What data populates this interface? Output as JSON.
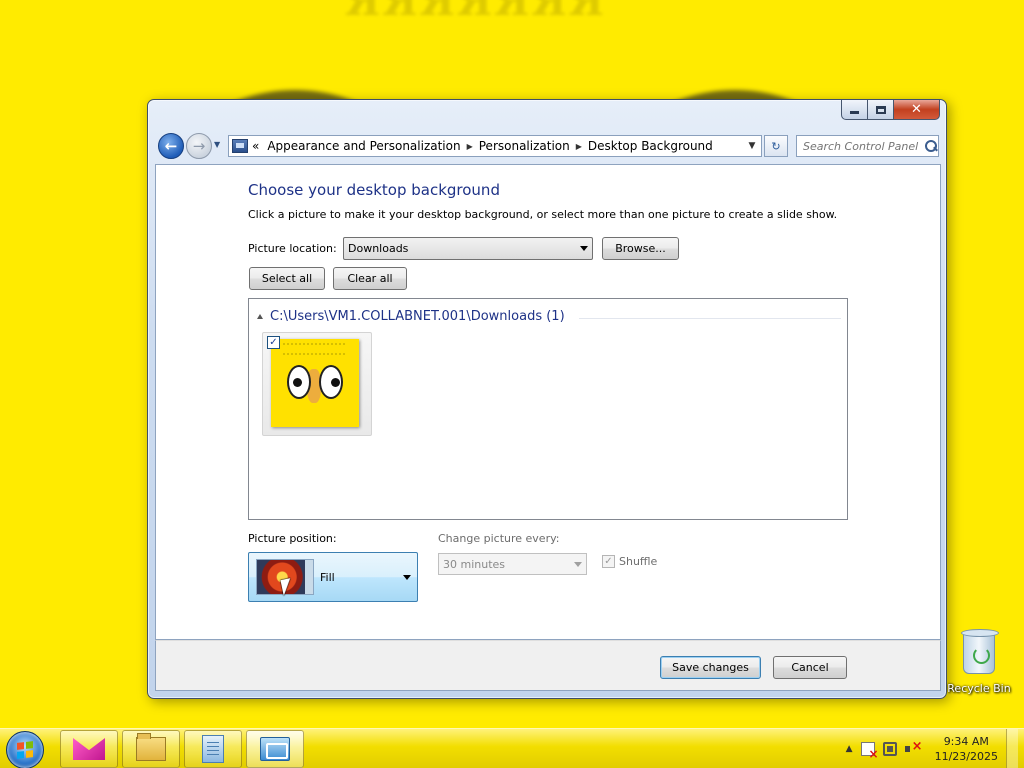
{
  "window": {
    "caption_buttons": {
      "minimize_icon": "minimize-icon",
      "maximize_icon": "maximize-icon",
      "close_icon": "close-icon",
      "close_glyph": "✕"
    }
  },
  "nav": {
    "back_glyph": "←",
    "forward_glyph": "→",
    "recent_glyph": "▼",
    "address_prefix": "«",
    "breadcrumb": [
      "Appearance and Personalization",
      "Personalization",
      "Desktop Background"
    ],
    "separator": "▶",
    "dropdown_glyph": "▼",
    "refresh_glyph": "↻",
    "search_placeholder": "Search Control Panel"
  },
  "main": {
    "title": "Choose your desktop background",
    "description": "Click a picture to make it your desktop background, or select more than one picture to create a slide show.",
    "picture_location_label": "Picture location:",
    "picture_location_value": "Downloads",
    "browse_label": "Browse...",
    "select_all_label": "Select all",
    "clear_all_label": "Clear all",
    "group_title": "C:\\Users\\VM1.COLLABNET.001\\Downloads (1)",
    "thumbnail_checked": true,
    "check_glyph": "✓",
    "picture_position_label": "Picture position:",
    "picture_position_value": "Fill",
    "change_every_label": "Change picture every:",
    "change_every_value": "30 minutes",
    "shuffle_label": "Shuffle",
    "shuffle_checked": true
  },
  "footer": {
    "save_label": "Save changes",
    "cancel_label": "Cancel"
  },
  "desktop": {
    "recycle_bin_label": "Recycle Bin"
  },
  "taskbar": {
    "pinned": [
      "pink-app-icon",
      "explorer-icon",
      "document-icon",
      "control-panel-icon"
    ],
    "tray_expand_glyph": "▲",
    "time": "9:34 AM",
    "date": "11/23/2025"
  }
}
